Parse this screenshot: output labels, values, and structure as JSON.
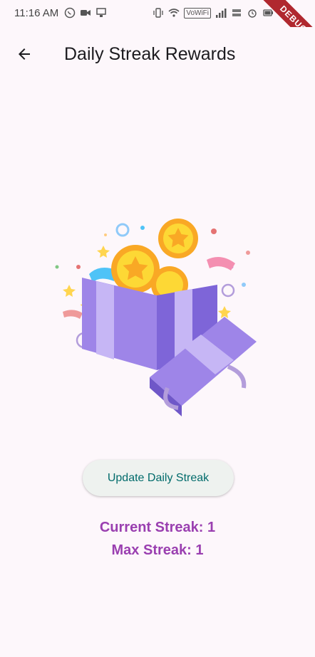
{
  "status": {
    "time": "11:16 AM",
    "left_icons": [
      "whatsapp-icon",
      "video-icon",
      "monitor-icon"
    ],
    "right_icons": [
      "vibrate-icon",
      "wifi-icon",
      "vowifi-badge",
      "signal-icon",
      "data-speed-icon",
      "alarm-icon",
      "battery-icon"
    ],
    "vowifi_label": "VoWiFi",
    "debug_label": "DEBUG"
  },
  "app_bar": {
    "title": "Daily Streak Rewards",
    "back_icon": "arrow-back-icon"
  },
  "hero": {
    "icon": "gift-box-with-coins-illustration"
  },
  "actions": {
    "update_label": "Update Daily Streak"
  },
  "streak": {
    "current_text": "Current Streak: 1",
    "max_text": "Max Streak: 1"
  },
  "colors": {
    "background": "#fdf7fb",
    "accent_purple": "#9a3fb0",
    "button_text": "#006b6b",
    "debug_ribbon": "#b0282f"
  }
}
